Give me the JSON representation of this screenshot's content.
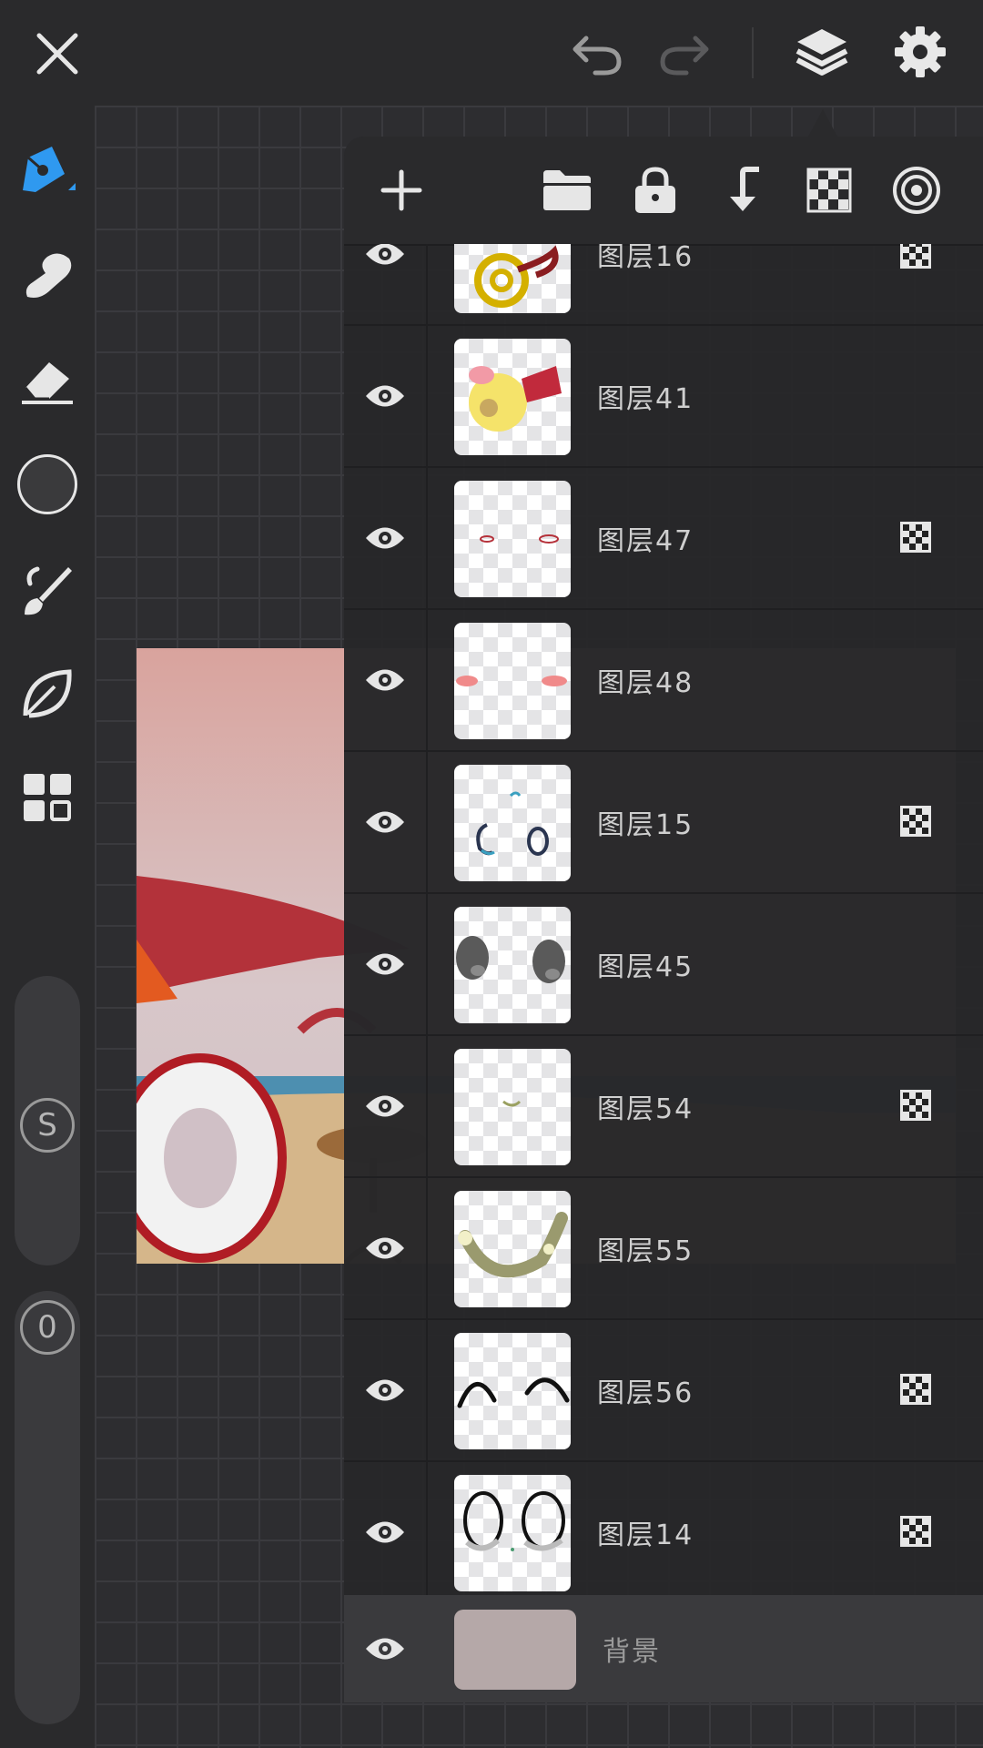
{
  "toolbar": {
    "close": "close",
    "undo": "undo",
    "redo": "redo",
    "layers": "layers",
    "settings": "settings"
  },
  "sidebar": {
    "tools": [
      "pen-icon",
      "smudge-icon",
      "eraser-icon",
      "color-swatch",
      "brush-icon",
      "leaf-icon",
      "grid-icon"
    ],
    "size_knob": "S",
    "opacity_knob": "0",
    "active_color": "#2f99f0"
  },
  "layer_panel": {
    "actions": [
      "add-layer",
      "folder",
      "lock",
      "merge-down",
      "transparency",
      "target"
    ],
    "layers": [
      {
        "name": "图层16",
        "visible": true,
        "masked": true
      },
      {
        "name": "图层41",
        "visible": true,
        "masked": false
      },
      {
        "name": "图层47",
        "visible": true,
        "masked": true
      },
      {
        "name": "图层48",
        "visible": true,
        "masked": false
      },
      {
        "name": "图层15",
        "visible": true,
        "masked": true
      },
      {
        "name": "图层45",
        "visible": true,
        "masked": false
      },
      {
        "name": "图层54",
        "visible": true,
        "masked": true
      },
      {
        "name": "图层55",
        "visible": true,
        "masked": false
      },
      {
        "name": "图层56",
        "visible": true,
        "masked": true
      },
      {
        "name": "图层14",
        "visible": true,
        "masked": true
      }
    ],
    "background": {
      "name": "背景",
      "visible": true,
      "color": "#b5a8a8"
    }
  }
}
